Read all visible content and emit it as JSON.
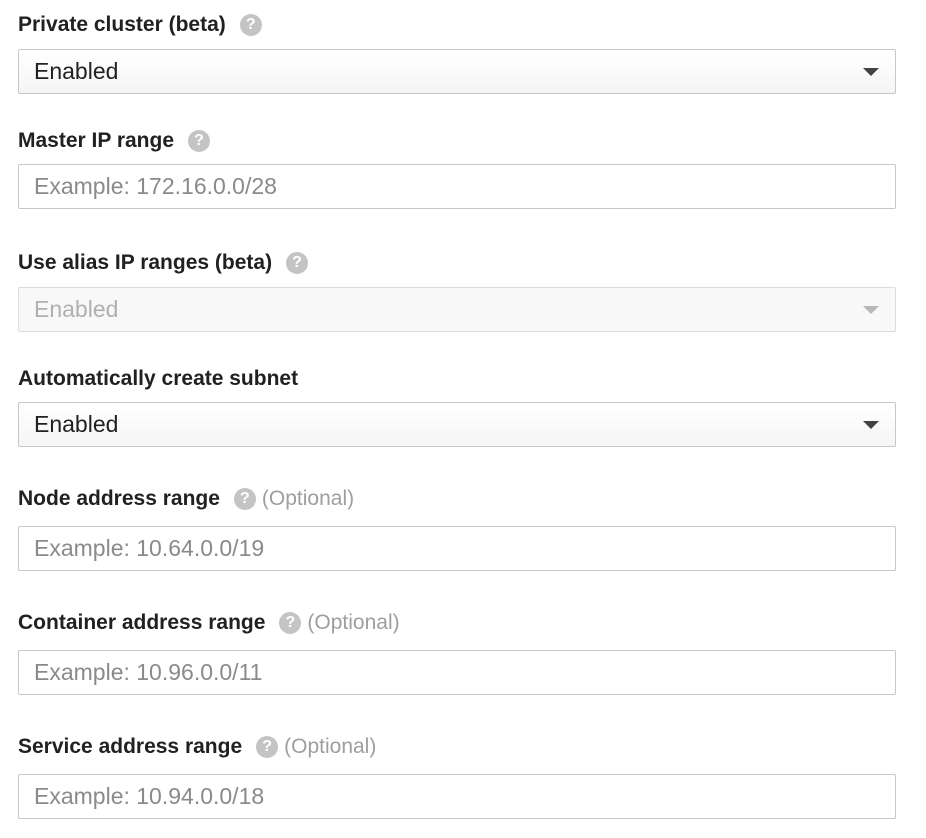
{
  "fields": {
    "private_cluster": {
      "label": "Private cluster (beta)",
      "help_icon": "help-circle-icon",
      "value": "Enabled"
    },
    "master_ip_range": {
      "label": "Master IP range",
      "help_icon": "help-circle-icon",
      "placeholder": "Example: 172.16.0.0/28"
    },
    "alias_ip_ranges": {
      "label": "Use alias IP ranges (beta)",
      "help_icon": "help-circle-icon",
      "value": "Enabled",
      "disabled": true
    },
    "create_subnet": {
      "label": "Automatically create subnet",
      "value": "Enabled"
    },
    "node_address_range": {
      "label": "Node address range",
      "help_icon": "help-circle-icon",
      "optional": "(Optional)",
      "placeholder": "Example: 10.64.0.0/19"
    },
    "container_address_range": {
      "label": "Container address range",
      "help_icon": "help-circle-icon",
      "optional": "(Optional)",
      "placeholder": "Example: 10.96.0.0/11"
    },
    "service_address_range": {
      "label": "Service address range",
      "help_icon": "help-circle-icon",
      "optional": "(Optional)",
      "placeholder": "Example: 10.94.0.0/18"
    }
  },
  "colors": {
    "label": "#212121",
    "help_icon": "#c4c4c4",
    "optional": "#9e9e9e",
    "border": "#c8c8c8",
    "placeholder": "#8a8a8a",
    "disabled_text": "#b0b0b0"
  }
}
